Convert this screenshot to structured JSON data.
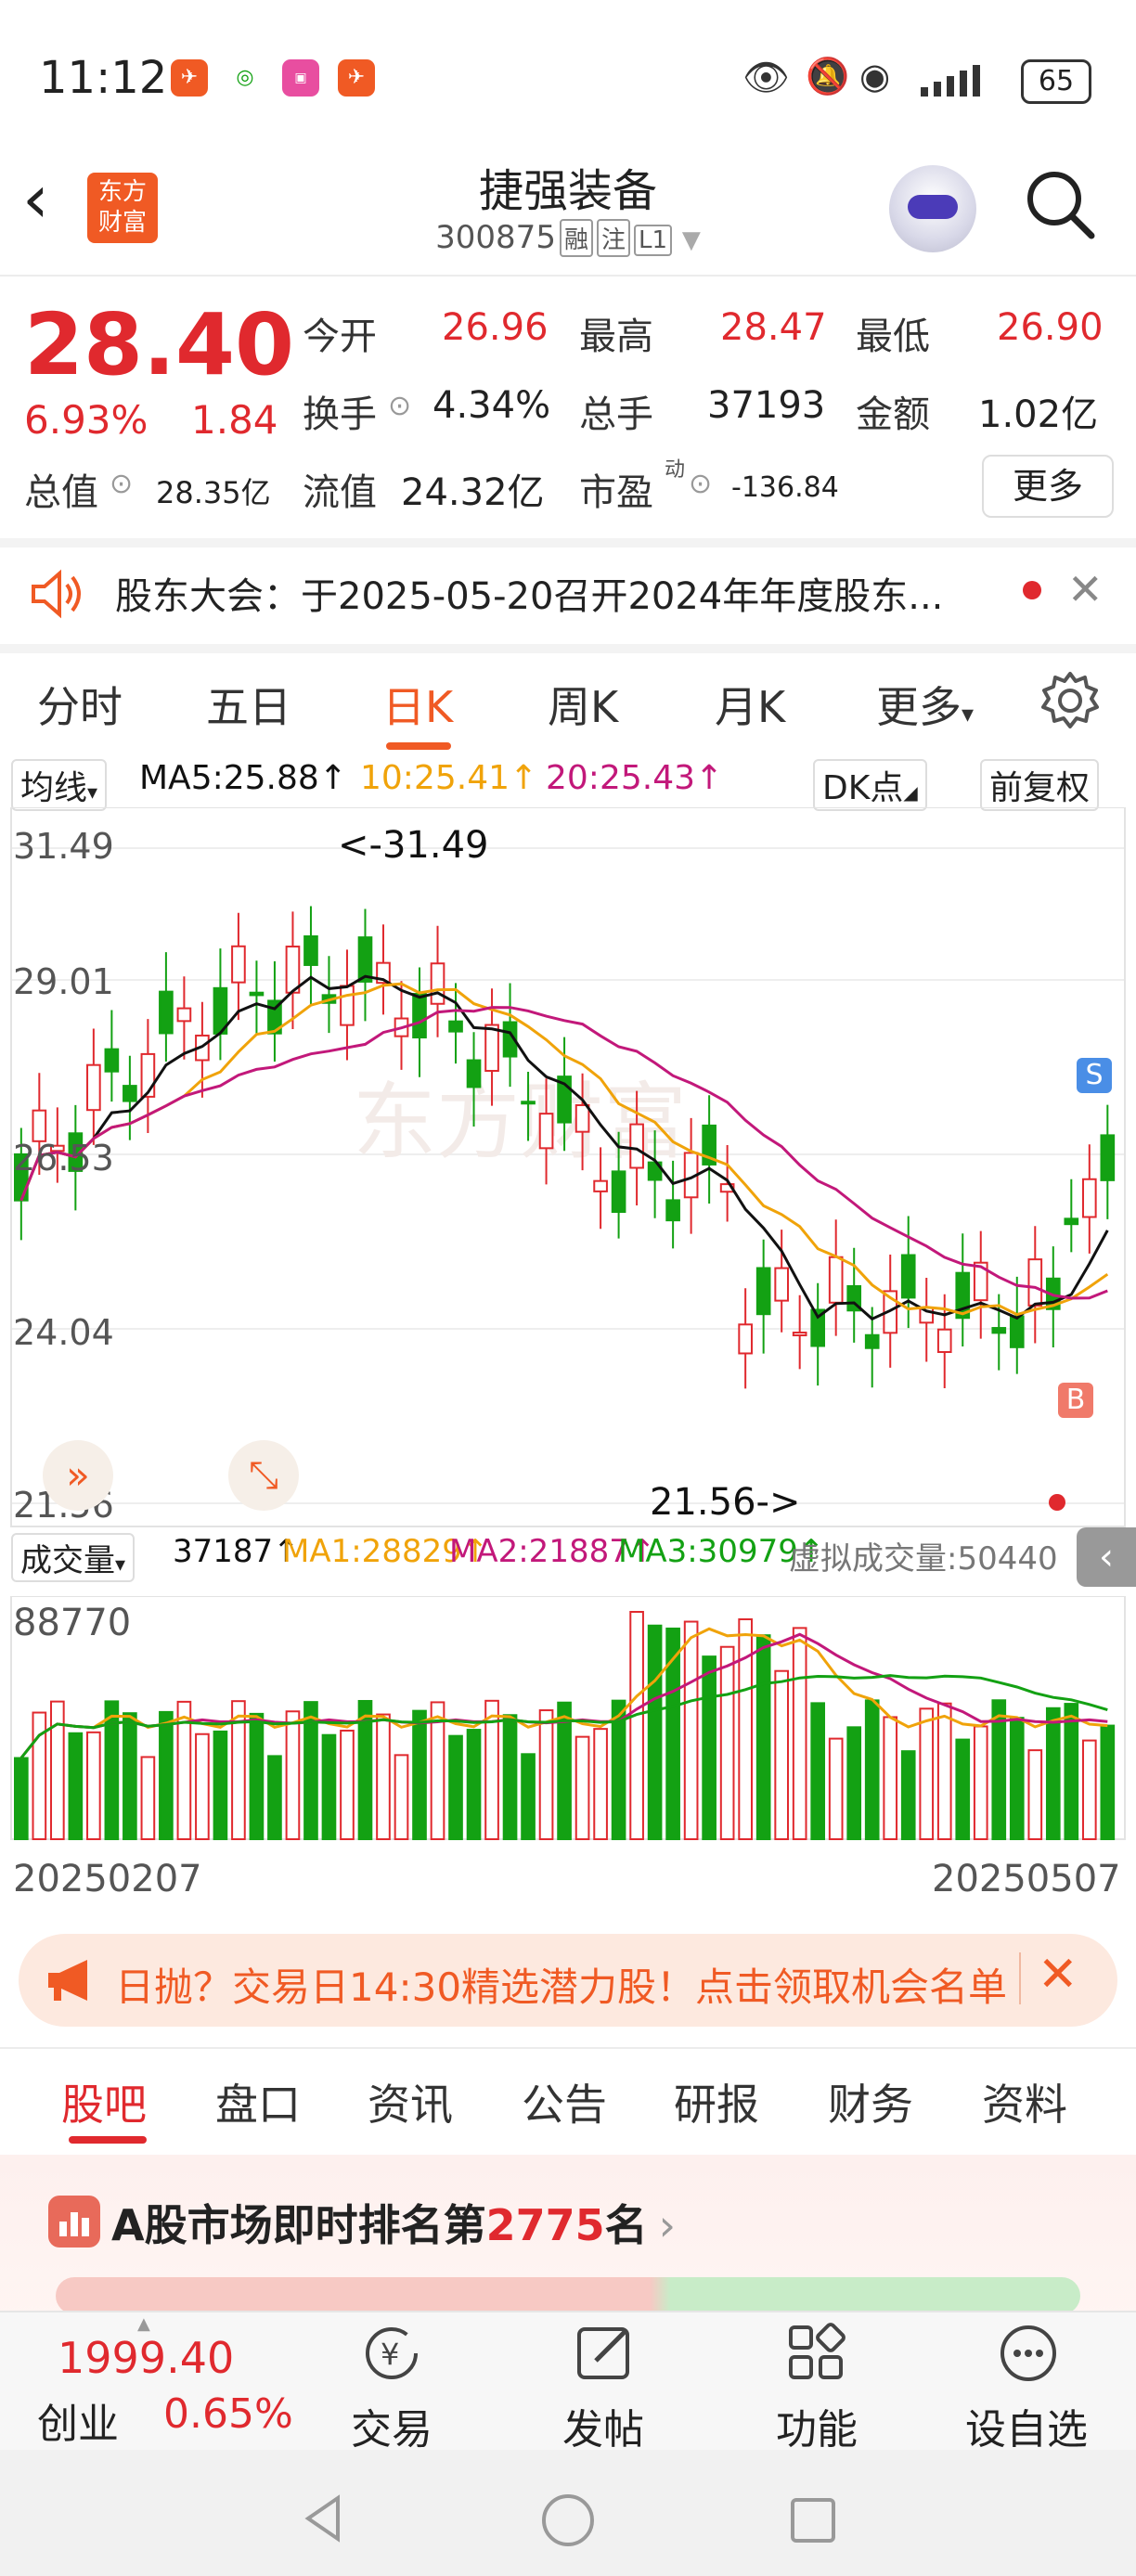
{
  "status_bar": {
    "time": "11:12",
    "battery": "65"
  },
  "header": {
    "logo_line1": "东方",
    "logo_line2": "财富",
    "title": "捷强装备",
    "code": "300875",
    "tags": [
      "融",
      "注",
      "L1"
    ]
  },
  "quote": {
    "price": "28.40",
    "change_pct": "6.93%",
    "change_amt": "1.84",
    "open_label": "今开",
    "open": "26.96",
    "high_label": "最高",
    "high": "28.47",
    "low_label": "最低",
    "low": "26.90",
    "turnover_label": "换手",
    "turnover": "4.34%",
    "volume_label": "总手",
    "volume": "37193",
    "amount_label": "金额",
    "amount": "1.02亿",
    "mcap_label": "总值",
    "mcap": "28.35亿",
    "float_label": "流值",
    "float": "24.32亿",
    "pe_label": "市盈",
    "pe_sup": "动",
    "pe": "-136.84",
    "more": "更多"
  },
  "notice": {
    "text": "股东大会：于2025-05-20召开2024年年度股东..."
  },
  "chart_tabs": {
    "items": [
      "分时",
      "五日",
      "日K",
      "周K",
      "月K",
      "更多"
    ],
    "active": "日K"
  },
  "ma_bar": {
    "selector": "均线",
    "ma5": "MA5:25.88↑",
    "ma10": "10:25.41↑",
    "ma20": "20:25.43↑",
    "dk": "DK点",
    "adjust": "前复权"
  },
  "kline": {
    "y_labels": [
      "31.49",
      "29.01",
      "26.53",
      "24.04",
      "21.56"
    ],
    "max_note": "<-31.49",
    "min_note": "21.56->",
    "sell_marker": "S",
    "buy_marker": "B",
    "watermark": "东方财富"
  },
  "volume_bar": {
    "selector": "成交量",
    "vol": "37187↑",
    "ma1": "MA1:28829↑",
    "ma2": "MA2:21887↑",
    "ma3": "MA3:30979↑",
    "virtual": "虚拟成交量:50440",
    "y_max": "88770"
  },
  "dates": {
    "start": "20250207",
    "end": "20250507"
  },
  "promo": {
    "text": "日抛？交易日14:30精选潜力股！点击领取机会名单"
  },
  "bottom_tabs": {
    "items": [
      "股吧",
      "盘口",
      "资讯",
      "公告",
      "研报",
      "财务",
      "资料"
    ],
    "active": "股吧"
  },
  "rank": {
    "prefix": "A股市场即时排名第",
    "number": "2775",
    "suffix": "名"
  },
  "footer": {
    "index_value": "1999.40",
    "index_name": "创业",
    "index_pct": "0.65%",
    "buttons": [
      "交易",
      "发帖",
      "功能",
      "设自选"
    ]
  },
  "colors": {
    "up": "#e0292e",
    "down": "#13a113",
    "accent": "#f05a24",
    "ma5": "#111111",
    "ma10": "#f0a30a",
    "ma20": "#c2187a"
  }
}
